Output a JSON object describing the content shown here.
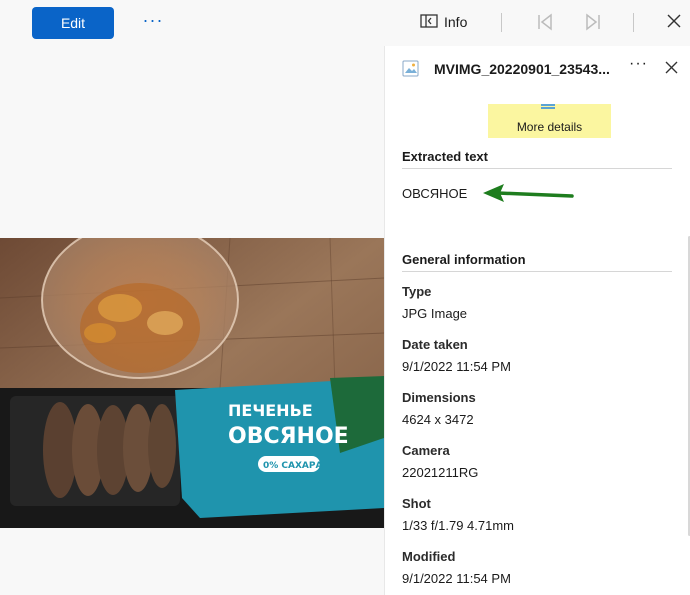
{
  "toolbar": {
    "edit_label": "Edit",
    "more_label": "···",
    "info_label": "Info"
  },
  "panel": {
    "file_name": "MVIMG_20220901_23543...",
    "more_label": "···",
    "more_details_label": "More details",
    "extracted_title": "Extracted text",
    "extracted_text": "ОВСЯНОЕ",
    "general_title": "General information",
    "fields": [
      {
        "label": "Type",
        "value": "JPG Image"
      },
      {
        "label": "Date taken",
        "value": "9/1/2022 11:54 PM"
      },
      {
        "label": "Dimensions",
        "value": "4624 x 3472"
      },
      {
        "label": "Camera",
        "value": "22021211RG"
      },
      {
        "label": "Shot",
        "value": "1/33 f/1.79 4.71mm"
      },
      {
        "label": "Modified",
        "value": "9/1/2022 11:54 PM"
      }
    ]
  },
  "photo": {
    "package_line1": "ПЕЧЕНЬЕ",
    "package_line2": "ОВСЯНОЕ",
    "package_badge": "0% САХАРА"
  },
  "colors": {
    "accent": "#0a64c8",
    "highlight": "#fbf6a0",
    "arrow": "#1e7d1e"
  }
}
